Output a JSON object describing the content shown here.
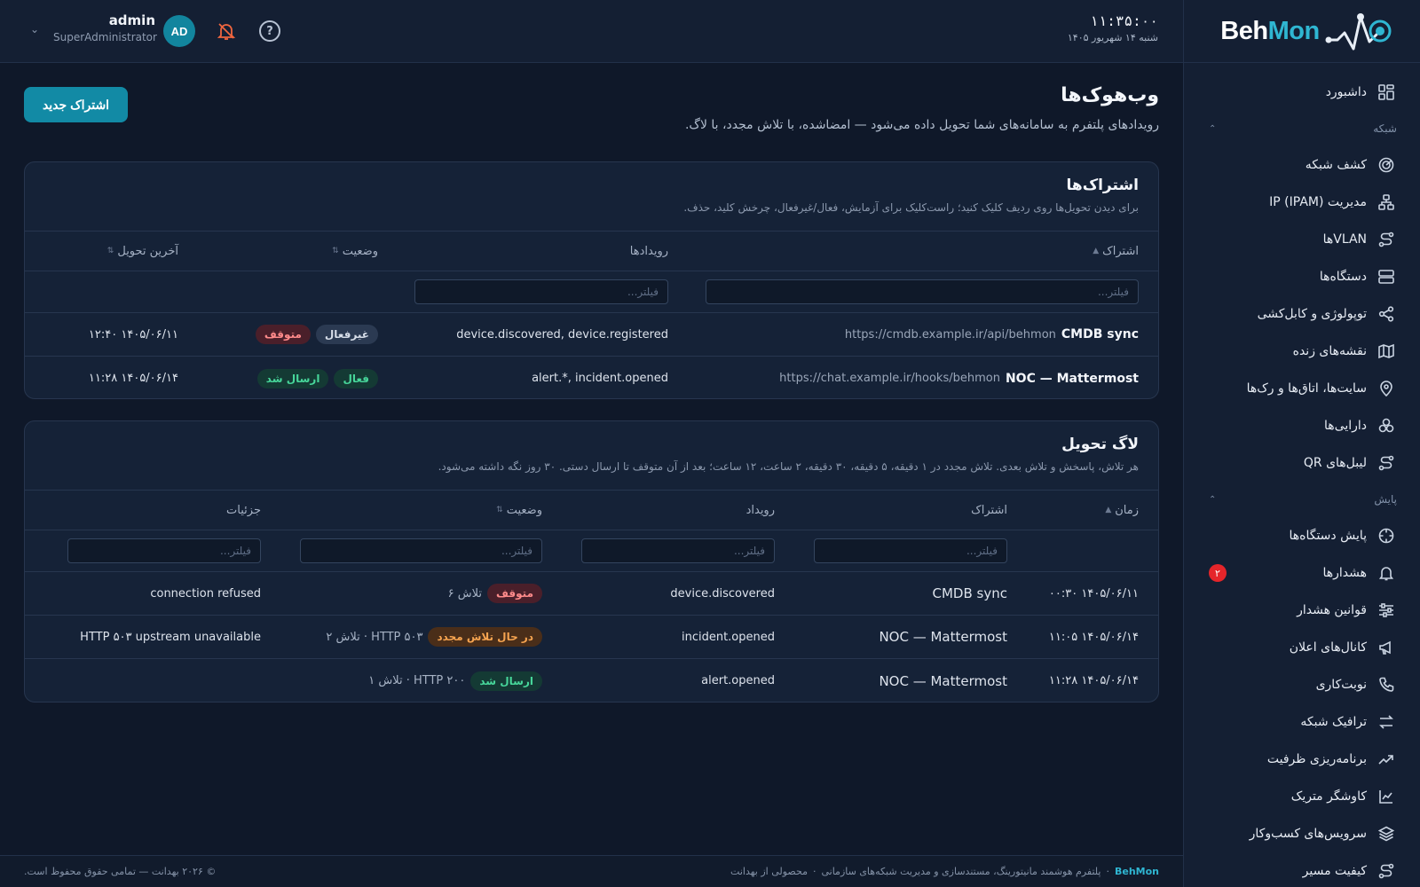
{
  "brand": {
    "part1": "Beh",
    "part2": "Mon"
  },
  "clock": {
    "time": "۱۱:۳۵:۰۰",
    "date": "شنبه ۱۴ شهریور ۱۴۰۵"
  },
  "user": {
    "name": "admin",
    "role": "SuperAdministrator",
    "initials": "AD"
  },
  "sidebar": {
    "top_item": "داشبورد",
    "groups": [
      {
        "label": "شبکه",
        "items": [
          "کشف شبکه",
          "مدیریت IP (IPAM)",
          "VLANها",
          "دستگاه‌ها",
          "توپولوژی و کابل‌کشی",
          "نقشه‌های زنده",
          "سایت‌ها، اتاق‌ها و رک‌ها",
          "دارایی‌ها",
          "لیبل‌های QR"
        ]
      },
      {
        "label": "پایش",
        "items": [
          "پایش دستگاه‌ها",
          "هشدارها",
          "قوانین هشدار",
          "کانال‌های اعلان",
          "نوبت‌کاری",
          "ترافیک شبکه",
          "برنامه‌ریزی ظرفیت",
          "کاوشگر متریک",
          "سرویس‌های کسب‌وکار",
          "کیفیت مسیر"
        ]
      }
    ],
    "alerts_badge": "۲"
  },
  "page": {
    "title": "وب‌هوک‌ها",
    "subtitle": "رویدادهای پلتفرم به سامانه‌های شما تحویل داده می‌شود — امضاشده، با تلاش مجدد، با لاگ.",
    "new_button": "اشتراک جدید"
  },
  "subscriptions": {
    "title": "اشتراک‌ها",
    "subtitle": "برای دیدن تحویل‌ها روی ردیف کلیک کنید؛ راست‌کلیک برای آزمایش، فعال/غیرفعال، چرخش کلید، حذف.",
    "columns": [
      "اشتراک",
      "رویدادها",
      "وضعیت",
      "آخرین تحویل"
    ],
    "filter_placeholder": "فیلتر...",
    "rows": [
      {
        "name": "CMDB sync",
        "url": "https://cmdb.example.ir/api/behmon",
        "events": "device.discovered, device.registered",
        "status1": "غیرفعال",
        "status2": "متوقف",
        "last": "۱۴۰۵/۰۶/۱۱ ۱۲:۴۰"
      },
      {
        "name": "NOC — Mattermost",
        "url": "https://chat.example.ir/hooks/behmon",
        "events": "alert.*, incident.opened",
        "status1": "فعال",
        "status2": "ارسال شد",
        "last": "۱۴۰۵/۰۶/۱۴ ۱۱:۲۸"
      }
    ]
  },
  "delivery_log": {
    "title": "لاگ تحویل",
    "subtitle": "هر تلاش، پاسخش و تلاش بعدی. تلاش مجدد در ۱ دقیقه، ۵ دقیقه، ۳۰ دقیقه، ۲ ساعت، ۱۲ ساعت؛ بعد از آن متوقف تا ارسال دستی. ۳۰ روز نگه داشته می‌شود.",
    "columns": [
      "زمان",
      "اشتراک",
      "رویداد",
      "وضعیت",
      "جزئیات"
    ],
    "filter_placeholder": "فیلتر...",
    "rows": [
      {
        "time": "۱۴۰۵/۰۶/۱۱ ۰۰:۳۰",
        "sub": "CMDB sync",
        "event": "device.discovered",
        "status": "متوقف",
        "meta": "تلاش ۶",
        "details": "connection refused"
      },
      {
        "time": "۱۴۰۵/۰۶/۱۴ ۱۱:۰۵",
        "sub": "NOC — Mattermost",
        "event": "incident.opened",
        "status": "در حال تلاش مجدد",
        "meta": "HTTP ۵۰۳ · تلاش ۲",
        "details": "HTTP ۵۰۳ upstream unavailable"
      },
      {
        "time": "۱۴۰۵/۰۶/۱۴ ۱۱:۲۸",
        "sub": "NOC — Mattermost",
        "event": "alert.opened",
        "status": "ارسال شد",
        "meta": "HTTP ۲۰۰ · تلاش ۱",
        "details": ""
      }
    ]
  },
  "footer": {
    "brand": "BehMon",
    "tagline": "پلتفرم هوشمند مانیتورینگ، مستندسازی و مدیریت شبکه‌های سازمانی",
    "product": "محصولی از بهدانت",
    "copyright": "© ۲۰۲۶ بهدانت — تمامی حقوق محفوظ است."
  },
  "colors": {
    "accent": "#128aa5",
    "brand_mon": "#2fb6d2",
    "danger": "#e5252a"
  }
}
